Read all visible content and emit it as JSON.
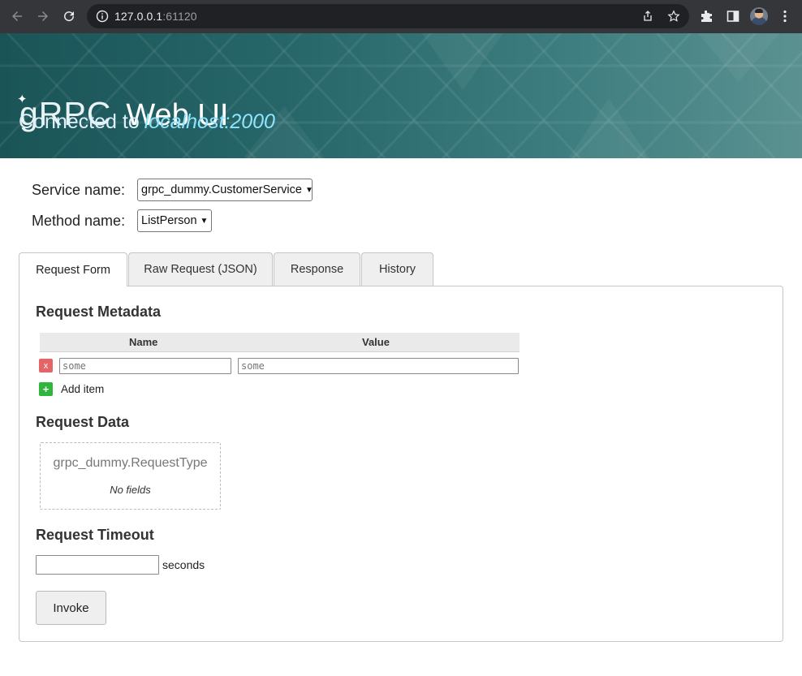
{
  "browser": {
    "url_host": "127.0.0.1",
    "url_port": ":61120"
  },
  "header": {
    "logo_text": "gRPC",
    "title": "Web UI",
    "connected_label": "Connected to",
    "connected_host": "localhost:2000"
  },
  "selectors": {
    "service_label": "Service name:",
    "service_value": "grpc_dummy.CustomerService",
    "method_label": "Method name:",
    "method_value": "ListPerson"
  },
  "tabs": [
    {
      "label": "Request Form",
      "active": true
    },
    {
      "label": "Raw Request (JSON)",
      "active": false
    },
    {
      "label": "Response",
      "active": false
    },
    {
      "label": "History",
      "active": false
    }
  ],
  "request_form": {
    "metadata_title": "Request Metadata",
    "metadata_columns": [
      "Name",
      "Value"
    ],
    "metadata_rows": [
      {
        "remove_label": "x",
        "name_placeholder": "some",
        "value_placeholder": "some"
      }
    ],
    "add_item_button": "+",
    "add_item_label": "Add item",
    "data_title": "Request Data",
    "data_type": "grpc_dummy.RequestType",
    "data_empty": "No fields",
    "timeout_title": "Request Timeout",
    "timeout_value": "",
    "timeout_unit": "seconds",
    "invoke_label": "Invoke"
  },
  "colors": {
    "chrome_bg": "#35363a",
    "banner_teal": "#266669",
    "host_highlight": "#8fe4ff",
    "remove_red": "#e66465",
    "add_green": "#2fb53a"
  }
}
